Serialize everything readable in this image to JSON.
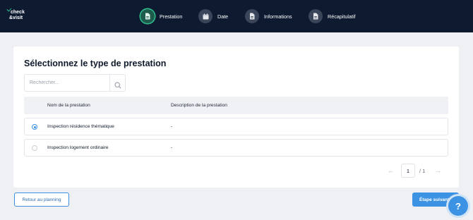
{
  "brand": {
    "line1": "check",
    "line2": "&visit"
  },
  "steps": [
    {
      "label": "Prestation",
      "active": true
    },
    {
      "label": "Date",
      "active": false
    },
    {
      "label": "Informations",
      "active": false
    },
    {
      "label": "Récapitulatif",
      "active": false
    }
  ],
  "page": {
    "title": "Sélectionnez le type de prestation"
  },
  "search": {
    "placeholder": "Rechercher..."
  },
  "table": {
    "columns": [
      "Nom de la prestation",
      "Description de la prestation"
    ],
    "rows": [
      {
        "name": "Inspection résidence thématique",
        "description": "-",
        "selected": true
      },
      {
        "name": "Inspection logement ordinaire",
        "description": "-",
        "selected": false
      }
    ]
  },
  "pagination": {
    "prev": "←",
    "current": "1",
    "total": "/ 1",
    "next": "→"
  },
  "footer": {
    "back_label": "Retour au planning",
    "next_label": "Étape suivante",
    "help": "?"
  },
  "colors": {
    "nav": "#0e1a30",
    "accent": "#3d93e3",
    "active_step": "#2ec28f"
  }
}
